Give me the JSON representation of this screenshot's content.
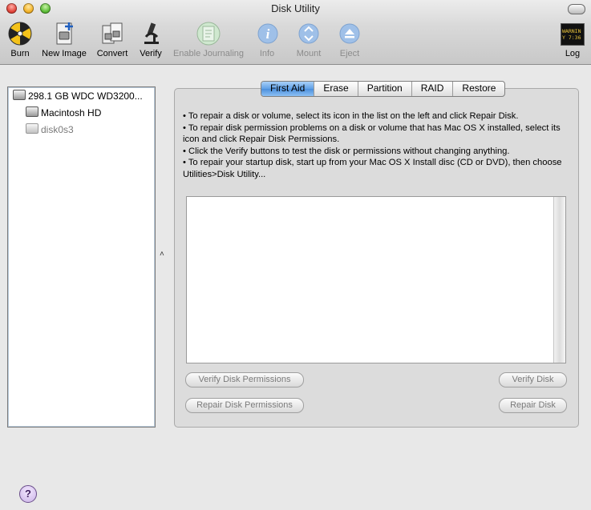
{
  "window": {
    "title": "Disk Utility"
  },
  "toolbar": {
    "items": [
      {
        "label": "Burn",
        "icon": "burn-icon",
        "enabled": true
      },
      {
        "label": "New Image",
        "icon": "new-image-icon",
        "enabled": true
      },
      {
        "label": "Convert",
        "icon": "convert-icon",
        "enabled": true
      },
      {
        "label": "Verify",
        "icon": "verify-microscope-icon",
        "enabled": true
      },
      {
        "label": "Enable Journaling",
        "icon": "journaling-icon",
        "enabled": false
      },
      {
        "label": "Info",
        "icon": "info-icon",
        "enabled": false
      },
      {
        "label": "Mount",
        "icon": "mount-icon",
        "enabled": false
      },
      {
        "label": "Eject",
        "icon": "eject-icon",
        "enabled": false
      },
      {
        "label": "Log",
        "icon": "log-icon",
        "enabled": true,
        "log_icon_text": "WARNIN\nY 7:36"
      }
    ]
  },
  "sidebar": {
    "disks": [
      {
        "label": "298.1 GB WDC WD3200...",
        "level": 0,
        "muted": false
      },
      {
        "label": "Macintosh HD",
        "level": 1,
        "muted": false
      },
      {
        "label": "disk0s3",
        "level": 1,
        "muted": true
      }
    ]
  },
  "tabs": [
    {
      "label": "First Aid",
      "active": true
    },
    {
      "label": "Erase",
      "active": false
    },
    {
      "label": "Partition",
      "active": false
    },
    {
      "label": "RAID",
      "active": false
    },
    {
      "label": "Restore",
      "active": false
    }
  ],
  "first_aid": {
    "instructions": [
      "• To repair a disk or volume, select its icon in the list on the left and click Repair Disk.",
      "• To repair disk permission problems on a disk or volume that has Mac OS X installed, select its icon and click Repair Disk Permissions.",
      "• Click the Verify buttons to test the disk or permissions without changing anything.",
      "• To repair your startup disk, start up from your Mac OS X Install disc (CD or DVD), then choose Utilities>Disk Utility..."
    ],
    "buttons": {
      "verify_permissions": "Verify Disk Permissions",
      "verify_disk": "Verify Disk",
      "repair_permissions": "Repair Disk Permissions",
      "repair_disk": "Repair Disk"
    }
  },
  "splitter_glyph": "˄",
  "help_label": "?"
}
